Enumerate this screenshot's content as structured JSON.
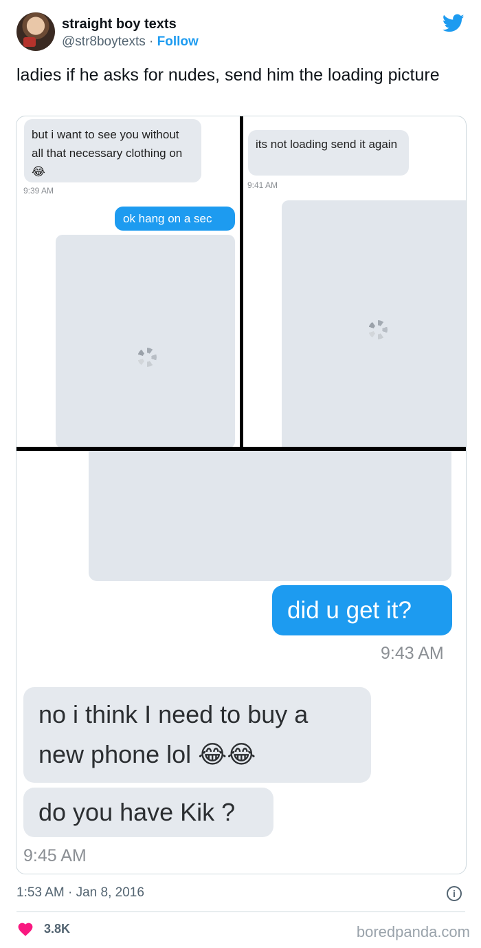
{
  "author": {
    "display_name": "straight boy texts",
    "handle": "@str8boytexts",
    "separator": "·",
    "follow_label": "Follow"
  },
  "tweet": {
    "text": "ladies if he asks for nudes, send him the loading picture",
    "timestamp": "1:53 AM · Jan 8, 2016",
    "likes": "3.8K",
    "info_glyph": "i"
  },
  "media": {
    "panel1": {
      "incoming": "but i want to see you without all that necessary clothing on 😂",
      "incoming_time": "9:39 AM",
      "outgoing": "ok hang on a sec"
    },
    "panel2": {
      "incoming": "its not loading send it again",
      "incoming_time": "9:41 AM"
    },
    "panel3": {
      "outgoing": "did u get it?",
      "outgoing_time": "9:43 AM",
      "incoming_1": "no i think I need to buy a new phone lol 😂😂",
      "incoming_2": "do you have Kik ?",
      "incoming_time": "9:45 AM"
    }
  },
  "watermark": "boredpanda.com",
  "colors": {
    "accent": "#1d9bf0",
    "heart": "#f91880",
    "incoming_bubble": "#e5e9ee",
    "placeholder": "#e1e6ec"
  },
  "icons": [
    "twitter-bird-icon",
    "heart-icon",
    "info-icon",
    "loading-spinner-icon"
  ]
}
